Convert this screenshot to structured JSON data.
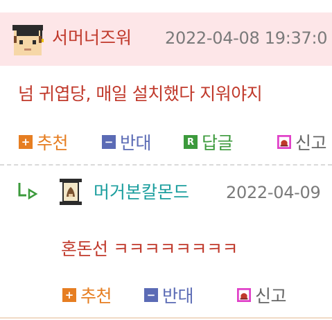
{
  "comment1": {
    "author": "서머너즈워",
    "timestamp": "2022-04-08 19:37:0",
    "text": "넘 귀엽당, 매일 설치했다 지워야지",
    "actions": {
      "recommend": {
        "icon_text": "+",
        "label": "추천"
      },
      "oppose": {
        "icon_text": "−",
        "label": "반대"
      },
      "reply": {
        "icon_text": "R",
        "label": "답글"
      },
      "report": {
        "label": "신고"
      }
    }
  },
  "reply1": {
    "author": "머거본칼몬드",
    "timestamp": "2022-04-09",
    "text": "혼돈선 ㅋㅋㅋㅋㅋㅋㅋㅋ",
    "actions": {
      "recommend": {
        "icon_text": "+",
        "label": "추천"
      },
      "oppose": {
        "icon_text": "−",
        "label": "반대"
      },
      "report": {
        "label": "신고"
      }
    }
  },
  "colors": {
    "header_bg": "#fde6e8",
    "author1": "#c0392b",
    "author2": "#1b9e9e",
    "comment_text": "#c0392b",
    "recommend": "#e67e22",
    "oppose": "#5b6bb5",
    "reply": "#3c9a3c",
    "report_icon": "#e040c8",
    "report_label": "#666666"
  },
  "icons": {
    "avatar1": "graduate-cap-avatar",
    "avatar2": "scroll-avatar",
    "reply_indicator": "reply-arrow-icon"
  }
}
